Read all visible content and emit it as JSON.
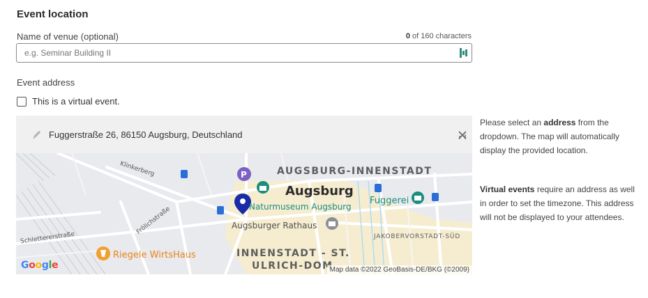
{
  "section": {
    "title": "Event location"
  },
  "venue": {
    "label": "Name of venue  (optional)",
    "char_count_current": "0",
    "char_count_suffix": " of 160 characters",
    "placeholder": "e.g. Seminar Building II",
    "value": ""
  },
  "address": {
    "label": "Event address",
    "virtual_checkbox_label": "This is a virtual event.",
    "virtual_checked": false,
    "selected": "Fuggerstraße 26, 86150 Augsburg, Deutschland"
  },
  "map": {
    "labels": {
      "innenstadt": "AUGSBURG-INNENSTADT",
      "city": "Augsburg",
      "naturmuseum": "Naturmuseum Augsburg",
      "fuggerei": "Fuggerei",
      "rathaus": "Augsburger Rathaus",
      "jakober": "JAKOBERVORSTADT-SÜD",
      "innenstadt_st_line1": "INNENSTADT - ST.",
      "innenstadt_st_line2": "ULRICH-DOM",
      "riegele": "Riegele WirtsHaus",
      "klinkerberg": "Klinkerberg",
      "froelich": "Frölichstraße",
      "schletterer": "Schlettererstraße"
    },
    "google_logo": "Google",
    "attribution": "Map data ©2022 GeoBasis-DE/BKG (©2009)",
    "colors": {
      "teal_poi": "#1a8c80",
      "orange_poi": "#e7841a",
      "marker": "#1a2ba8"
    }
  },
  "info": {
    "p1_before": "Please select an ",
    "p1_bold": "address",
    "p1_after": " from the dropdown. The map will automatically display the provided location.",
    "p2_bold": "Virtual events",
    "p2_after": " require an address as well in order to set the timezone. This address will not be displayed to your attendees."
  }
}
